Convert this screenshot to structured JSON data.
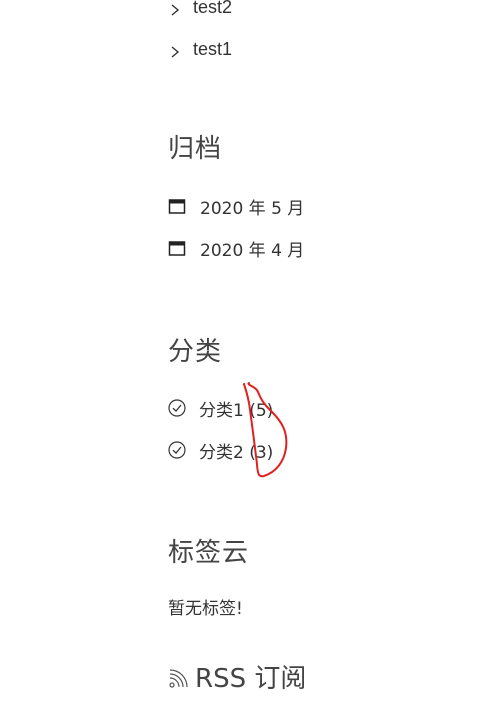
{
  "recent": {
    "items": [
      {
        "label": "test2"
      },
      {
        "label": "test1"
      }
    ]
  },
  "archive": {
    "title": "归档",
    "items": [
      {
        "label": "2020 年 5 月"
      },
      {
        "label": "2020 年 4 月"
      }
    ]
  },
  "categories": {
    "title": "分类",
    "items": [
      {
        "label": "分类1 (5)"
      },
      {
        "label": "分类2 (3)"
      }
    ]
  },
  "tags": {
    "title": "标签云",
    "empty_text": "暂无标签!"
  },
  "rss": {
    "title": "RSS 订阅"
  },
  "icons": {
    "recent": "chevron-right-icon",
    "archive": "calendar-icon",
    "categories": "check-circle-icon",
    "rss": "rss-icon"
  },
  "colors": {
    "text": "#333333",
    "heading": "#444444",
    "annotation": "#e02020"
  }
}
